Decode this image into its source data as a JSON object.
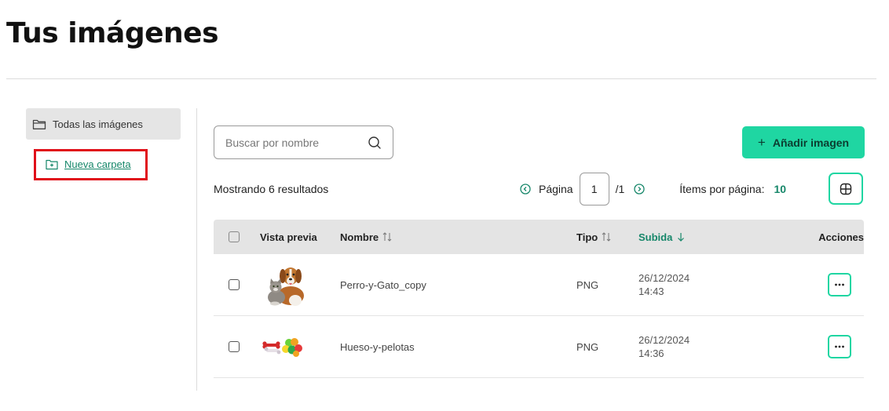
{
  "page": {
    "title": "Tus imágenes"
  },
  "sidebar": {
    "all_images_label": "Todas las imágenes",
    "new_folder_label": "Nueva carpeta"
  },
  "search": {
    "placeholder": "Buscar por nombre",
    "value": ""
  },
  "toolbar": {
    "add_image_label": "Añadir imagen",
    "add_icon": "+"
  },
  "results": {
    "text": "Mostrando 6 resultados"
  },
  "pagination": {
    "page_label": "Página",
    "current_page": "1",
    "total_pages": "/1",
    "items_per_page_label": "Ítems por página:",
    "items_per_page": "10"
  },
  "table": {
    "headers": {
      "preview": "Vista previa",
      "name": "Nombre",
      "type": "Tipo",
      "uploaded": "Subida",
      "actions": "Acciones"
    },
    "rows": [
      {
        "name": "Perro-y-Gato_copy",
        "type": "PNG",
        "date": "26/12/2024",
        "time": "14:43",
        "preview_icon": "dog-cat-photo"
      },
      {
        "name": "Hueso-y-pelotas",
        "type": "PNG",
        "date": "26/12/2024",
        "time": "14:36",
        "preview_icon": "bone-balls-photo"
      }
    ]
  },
  "colors": {
    "accent": "#1fd6a2",
    "accent_text": "#17876a",
    "highlight_border": "#e0101a",
    "header_bg": "#e4e4e4"
  }
}
